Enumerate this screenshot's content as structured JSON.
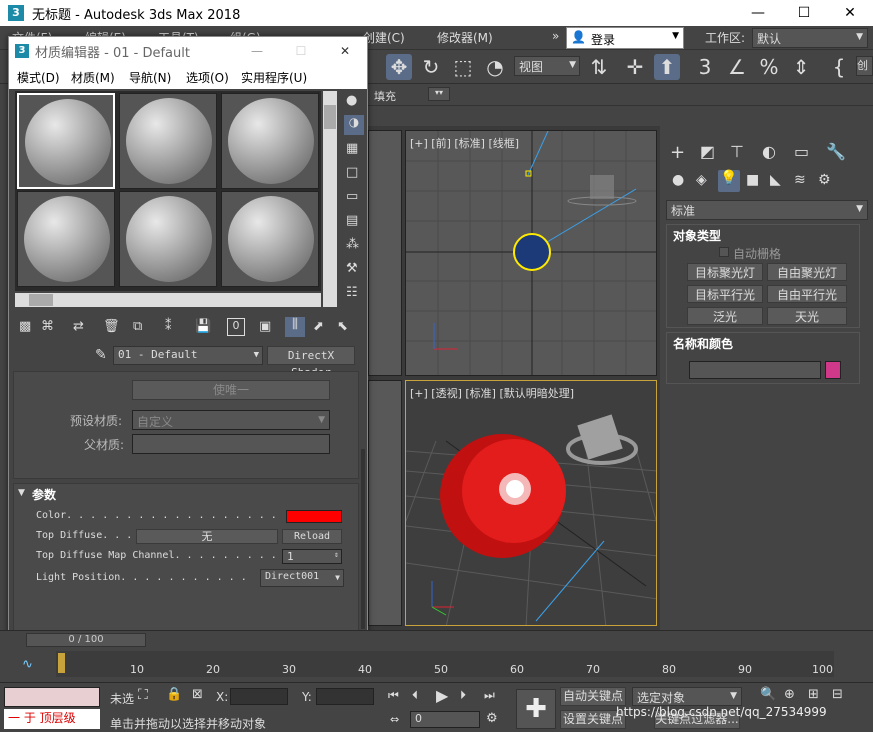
{
  "window": {
    "title": "无标题 - Autodesk 3ds Max 2018",
    "app_icon": "3",
    "min_icon": "—",
    "max_icon": "☐",
    "close_icon": "✕"
  },
  "menubar": {
    "items": [
      "文件(F)",
      "编辑(E)",
      "工具(T)",
      "组(G)",
      "创建(C)",
      "修改器(M)"
    ],
    "more": "»",
    "login": "登录",
    "workspace_label": "工作区:",
    "workspace_value": "默认"
  },
  "toolbar": {
    "view_label": "视图",
    "create_label": "创",
    "fill_label": "填充"
  },
  "viewports": {
    "front_label": "[+] [前] [标准] [线框]",
    "persp_label": "[+] [透视] [标准] [默认明暗处理]"
  },
  "command_panel": {
    "category_value": "标准",
    "object_type_title": "对象类型",
    "auto_grid": "自动栅格",
    "buttons": [
      "目标聚光灯",
      "自由聚光灯",
      "目标平行光",
      "自由平行光",
      "泛光",
      "天光"
    ],
    "name_color_title": "名称和颜色",
    "object_color": "#d0388a"
  },
  "material_editor": {
    "title": "材质编辑器 - 01 - Default",
    "icon": "3",
    "menu": [
      "模式(D)",
      "材质(M)",
      "导航(N)",
      "选项(O)",
      "实用程序(U)"
    ],
    "material_name": "01 - Default",
    "shader_button": "DirectX Shader",
    "make_unique": "使唯一",
    "preset_label": "预设材质:",
    "preset_value": "自定义",
    "parent_label": "父材质:",
    "params_title": "参数",
    "params": {
      "color_label": "Color. . . . . . . . . . . . . . . . . .",
      "color_value": "#ff0000",
      "top_diffuse_label": "Top Diffuse. . .",
      "top_diffuse_value": "无",
      "reload": "Reload",
      "channel_label": "Top Diffuse Map Channel. . . . . . . . .",
      "channel_value": "1",
      "light_label": "Light Position. . . . . . . . . . .",
      "light_value": "Direct001"
    }
  },
  "timeline": {
    "frame_display": "0 / 100",
    "ticks": [
      "10",
      "20",
      "30",
      "40",
      "50",
      "60",
      "70",
      "80",
      "90",
      "100"
    ]
  },
  "status": {
    "selection": "一 于 顶层级",
    "unselected": "未选",
    "x_label": "X:",
    "y_label": "Y:",
    "hint": "单击并拖动以选择并移动对象",
    "auto_key": "自动关键点",
    "set_key": "设置关键点",
    "selected_object": "选定对象",
    "key_filter": "关键点过滤器...",
    "frame_value": "0",
    "watermark": "https://blog.csdn.net/qq_27534999"
  }
}
